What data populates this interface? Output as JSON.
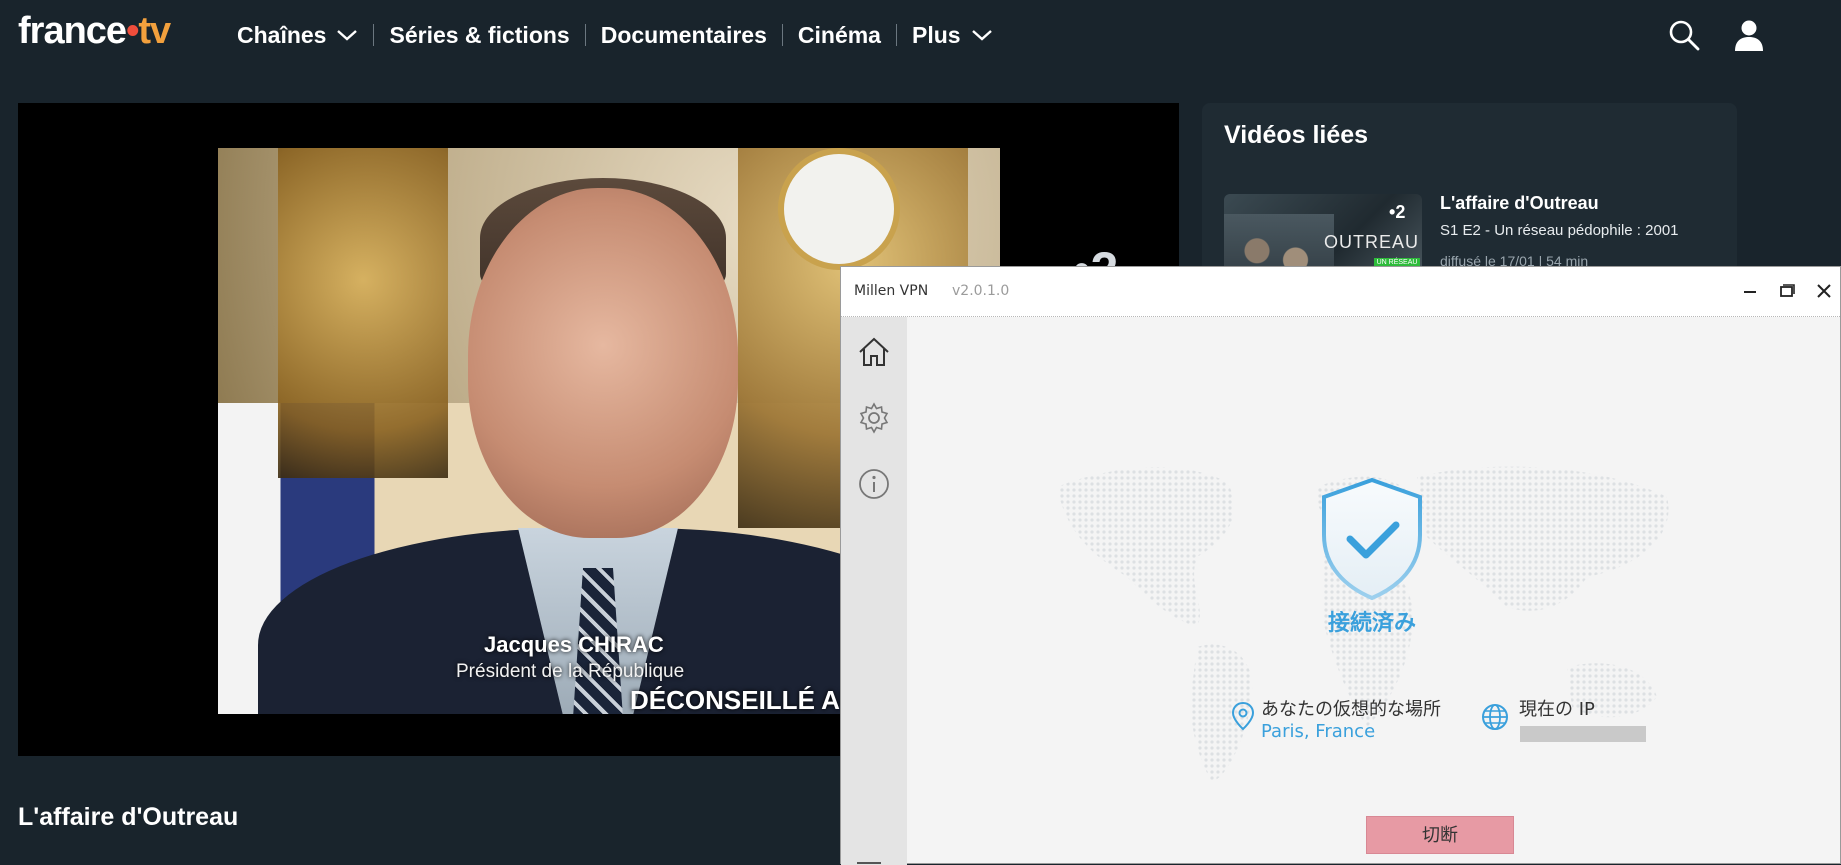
{
  "header": {
    "logo": {
      "brand": "france",
      "suffix": "tv"
    },
    "nav": [
      {
        "label": "Chaînes",
        "dropdown": true
      },
      {
        "label": "Séries & fictions",
        "dropdown": false
      },
      {
        "label": "Documentaires",
        "dropdown": false
      },
      {
        "label": "Cinéma",
        "dropdown": false
      },
      {
        "label": "Plus",
        "dropdown": true
      }
    ],
    "icons": [
      "search-icon",
      "account-icon"
    ]
  },
  "player": {
    "channel": "2",
    "caption_name": "Jacques CHIRAC",
    "caption_role": "Président de la République",
    "warning_text": "DÉCONSEILLÉ AUX"
  },
  "show": {
    "title": "L'affaire d'Outreau"
  },
  "related": {
    "heading": "Vidéos liées",
    "items": [
      {
        "title": "L'affaire d'Outreau",
        "subtitle": "S1 E2 - Un réseau pédophile : 2001",
        "meta": "diffusé le 17/01 | 54 min",
        "thumb_channel": "2",
        "thumb_text": "OUTREAU",
        "thumb_badge": "UN RÉSEAU"
      }
    ]
  },
  "vpn": {
    "app_name": "Millen VPN",
    "version": "v2.0.1.0",
    "status": "接続済み",
    "location_label": "あなたの仮想的な場所",
    "location_value": "Paris, France",
    "ip_label": "現在の IP",
    "disconnect_label": "切断",
    "sidebar_icons": [
      "home-icon",
      "gear-icon",
      "info-icon"
    ],
    "accent_color": "#3aa0dc",
    "disconnect_color": "#e79aa4"
  }
}
